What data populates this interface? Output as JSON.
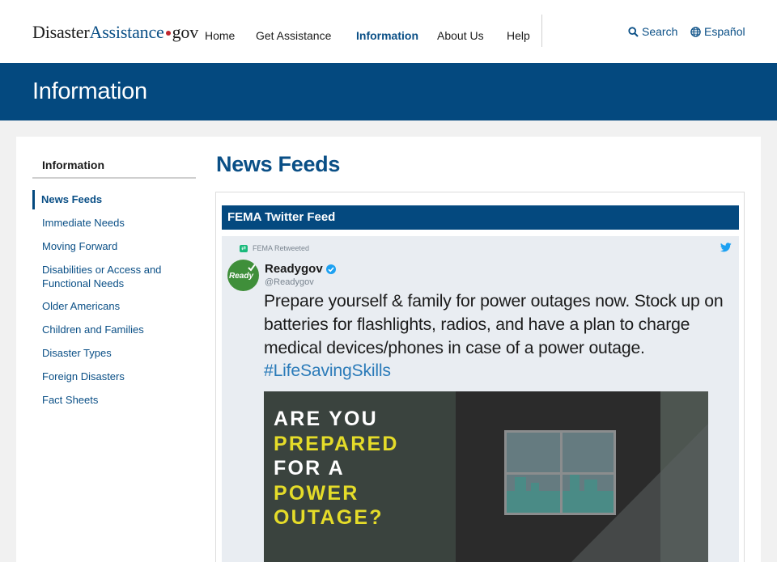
{
  "header": {
    "logo": {
      "part1": "Disaster",
      "part2": "Assistance",
      "part3": "gov"
    },
    "nav": [
      "Home",
      "Get Assistance",
      "Information",
      "About Us",
      "Help"
    ],
    "active_nav": "Information",
    "search_label": "Search",
    "language_label": "Español"
  },
  "banner": {
    "title": "Information"
  },
  "sidebar": {
    "title": "Information",
    "items": [
      "News Feeds",
      "Immediate Needs",
      "Moving Forward",
      "Disabilities or Access and Functional Needs",
      "Older Americans",
      "Children and Families",
      "Disaster Types",
      "Foreign Disasters",
      "Fact Sheets"
    ],
    "active_item": "News Feeds"
  },
  "main": {
    "title": "News Feeds",
    "feed_title": "FEMA Twitter Feed",
    "tweet": {
      "retweet_label": "FEMA Retweeted",
      "avatar_text": "Ready",
      "name": "Readygov",
      "handle": "@Readygov",
      "text": "Prepare yourself & family for power outages now. Stock up on batteries for flashlights, radios, and have a plan to charge medical devices/phones in case of a power outage.",
      "hashtag": "#LifeSavingSkills",
      "image_lines": [
        "ARE YOU",
        "PREPARED",
        "FOR A",
        "POWER",
        "OUTAGE?"
      ]
    }
  },
  "colors": {
    "brand_blue": "#04497f",
    "link_blue": "#0a4f86",
    "logo_red": "#c0262d",
    "image_yellow": "#e5dc29",
    "twitter_blue": "#1da1f2"
  },
  "icons": {
    "search": "search-icon",
    "language": "globe-icon",
    "retweet": "retweet-icon",
    "twitter": "twitter-bird-icon",
    "verified": "verified-badge-icon"
  }
}
